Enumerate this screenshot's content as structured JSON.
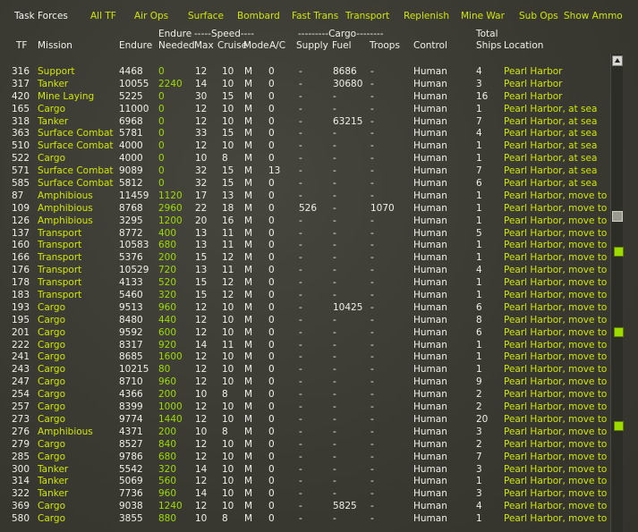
{
  "menu": {
    "task_forces": "Task Forces",
    "items": [
      "All TF",
      "Air Ops",
      "Surface",
      "Bombard",
      "Fast Trans",
      "Transport",
      "Replenish",
      "Mine War",
      "Sub Ops",
      "Show Ammo"
    ]
  },
  "headers": {
    "tf": "TF",
    "mission": "Mission",
    "endure": "Endure",
    "endure_top": "Endure",
    "needed": "Needed",
    "speed_group": "-----Speed----",
    "max": "Max",
    "cruise": "Cruise",
    "mode": "Mode",
    "ac": "A/C",
    "cargo_group": "---------Cargo--------",
    "supply": "Supply",
    "fuel": "Fuel",
    "troops": "Troops",
    "control": "Control",
    "total": "Total",
    "ships": "Ships",
    "location": "Location"
  },
  "rows": [
    {
      "tf": "316",
      "mission": "Support",
      "endure": "4468",
      "needed": "0",
      "max": "12",
      "cruise": "10",
      "mode": "M",
      "ac": "0",
      "supply": "-",
      "fuel": "8686",
      "troops": "-",
      "control": "Human",
      "ships": "4",
      "location": "Pearl Harbor"
    },
    {
      "tf": "317",
      "mission": "Tanker",
      "endure": "10055",
      "needed": "2240",
      "max": "14",
      "cruise": "10",
      "mode": "M",
      "ac": "0",
      "supply": "-",
      "fuel": "30680",
      "troops": "-",
      "control": "Human",
      "ships": "3",
      "location": "Pearl Harbor"
    },
    {
      "tf": "420",
      "mission": "Mine Laying",
      "endure": "5225",
      "needed": "0",
      "max": "30",
      "cruise": "15",
      "mode": "M",
      "ac": "0",
      "supply": "-",
      "fuel": "-",
      "troops": "-",
      "control": "Human",
      "ships": "16",
      "location": "Pearl Harbor"
    },
    {
      "tf": "165",
      "mission": "Cargo",
      "endure": "11000",
      "needed": "0",
      "max": "12",
      "cruise": "10",
      "mode": "M",
      "ac": "0",
      "supply": "-",
      "fuel": "-",
      "troops": "-",
      "control": "Human",
      "ships": "1",
      "location": "Pearl Harbor, at sea"
    },
    {
      "tf": "318",
      "mission": "Tanker",
      "endure": "6968",
      "needed": "0",
      "max": "12",
      "cruise": "10",
      "mode": "M",
      "ac": "0",
      "supply": "-",
      "fuel": "63215",
      "troops": "-",
      "control": "Human",
      "ships": "7",
      "location": "Pearl Harbor, at sea"
    },
    {
      "tf": "363",
      "mission": "Surface Combat",
      "endure": "5781",
      "needed": "0",
      "max": "33",
      "cruise": "15",
      "mode": "M",
      "ac": "0",
      "supply": "-",
      "fuel": "-",
      "troops": "-",
      "control": "Human",
      "ships": "4",
      "location": "Pearl Harbor, at sea"
    },
    {
      "tf": "510",
      "mission": "Surface Combat",
      "endure": "4000",
      "needed": "0",
      "max": "12",
      "cruise": "10",
      "mode": "M",
      "ac": "0",
      "supply": "-",
      "fuel": "-",
      "troops": "-",
      "control": "Human",
      "ships": "1",
      "location": "Pearl Harbor, at sea"
    },
    {
      "tf": "522",
      "mission": "Cargo",
      "endure": "4000",
      "needed": "0",
      "max": "10",
      "cruise": "8",
      "mode": "M",
      "ac": "0",
      "supply": "-",
      "fuel": "-",
      "troops": "-",
      "control": "Human",
      "ships": "1",
      "location": "Pearl Harbor, at sea"
    },
    {
      "tf": "571",
      "mission": "Surface Combat",
      "endure": "9089",
      "needed": "0",
      "max": "32",
      "cruise": "15",
      "mode": "M",
      "ac": "13",
      "supply": "-",
      "fuel": "-",
      "troops": "-",
      "control": "Human",
      "ships": "7",
      "location": "Pearl Harbor, at sea"
    },
    {
      "tf": "585",
      "mission": "Surface Combat",
      "endure": "5812",
      "needed": "0",
      "max": "32",
      "cruise": "15",
      "mode": "M",
      "ac": "0",
      "supply": "-",
      "fuel": "-",
      "troops": "-",
      "control": "Human",
      "ships": "6",
      "location": "Pearl Harbor, at sea"
    },
    {
      "tf": "87",
      "mission": "Amphibious",
      "endure": "11459",
      "needed": "1120",
      "max": "17",
      "cruise": "13",
      "mode": "M",
      "ac": "0",
      "supply": "-",
      "fuel": "-",
      "troops": "-",
      "control": "Human",
      "ships": "1",
      "location": "Pearl Harbor, move to"
    },
    {
      "tf": "109",
      "mission": "Amphibious",
      "endure": "8768",
      "needed": "2960",
      "max": "22",
      "cruise": "18",
      "mode": "M",
      "ac": "0",
      "supply": "526",
      "fuel": "-",
      "troops": "1070",
      "control": "Human",
      "ships": "1",
      "location": "Pearl Harbor, move to"
    },
    {
      "tf": "126",
      "mission": "Amphibious",
      "endure": "3295",
      "needed": "1200",
      "max": "20",
      "cruise": "16",
      "mode": "M",
      "ac": "0",
      "supply": "-",
      "fuel": "-",
      "troops": "-",
      "control": "Human",
      "ships": "1",
      "location": "Pearl Harbor, move to"
    },
    {
      "tf": "137",
      "mission": "Transport",
      "endure": "8772",
      "needed": "400",
      "max": "13",
      "cruise": "11",
      "mode": "M",
      "ac": "0",
      "supply": "-",
      "fuel": "-",
      "troops": "-",
      "control": "Human",
      "ships": "5",
      "location": "Pearl Harbor, move to"
    },
    {
      "tf": "160",
      "mission": "Transport",
      "endure": "10583",
      "needed": "680",
      "max": "13",
      "cruise": "11",
      "mode": "M",
      "ac": "0",
      "supply": "-",
      "fuel": "-",
      "troops": "-",
      "control": "Human",
      "ships": "1",
      "location": "Pearl Harbor, move to"
    },
    {
      "tf": "166",
      "mission": "Transport",
      "endure": "5376",
      "needed": "200",
      "max": "15",
      "cruise": "12",
      "mode": "M",
      "ac": "0",
      "supply": "-",
      "fuel": "-",
      "troops": "-",
      "control": "Human",
      "ships": "1",
      "location": "Pearl Harbor, move to"
    },
    {
      "tf": "176",
      "mission": "Transport",
      "endure": "10529",
      "needed": "720",
      "max": "13",
      "cruise": "11",
      "mode": "M",
      "ac": "0",
      "supply": "-",
      "fuel": "-",
      "troops": "-",
      "control": "Human",
      "ships": "4",
      "location": "Pearl Harbor, move to"
    },
    {
      "tf": "178",
      "mission": "Transport",
      "endure": "4133",
      "needed": "520",
      "max": "15",
      "cruise": "12",
      "mode": "M",
      "ac": "0",
      "supply": "-",
      "fuel": "-",
      "troops": "-",
      "control": "Human",
      "ships": "1",
      "location": "Pearl Harbor, move to"
    },
    {
      "tf": "183",
      "mission": "Transport",
      "endure": "5460",
      "needed": "320",
      "max": "15",
      "cruise": "12",
      "mode": "M",
      "ac": "0",
      "supply": "-",
      "fuel": "-",
      "troops": "-",
      "control": "Human",
      "ships": "1",
      "location": "Pearl Harbor, move to"
    },
    {
      "tf": "193",
      "mission": "Cargo",
      "endure": "9513",
      "needed": "960",
      "max": "12",
      "cruise": "10",
      "mode": "M",
      "ac": "0",
      "supply": "-",
      "fuel": "10425",
      "troops": "-",
      "control": "Human",
      "ships": "6",
      "location": "Pearl Harbor, move to"
    },
    {
      "tf": "195",
      "mission": "Cargo",
      "endure": "8480",
      "needed": "440",
      "max": "12",
      "cruise": "10",
      "mode": "M",
      "ac": "0",
      "supply": "-",
      "fuel": "-",
      "troops": "-",
      "control": "Human",
      "ships": "8",
      "location": "Pearl Harbor, move to"
    },
    {
      "tf": "201",
      "mission": "Cargo",
      "endure": "9592",
      "needed": "600",
      "max": "12",
      "cruise": "10",
      "mode": "M",
      "ac": "0",
      "supply": "-",
      "fuel": "-",
      "troops": "-",
      "control": "Human",
      "ships": "6",
      "location": "Pearl Harbor, move to"
    },
    {
      "tf": "222",
      "mission": "Cargo",
      "endure": "8317",
      "needed": "920",
      "max": "14",
      "cruise": "11",
      "mode": "M",
      "ac": "0",
      "supply": "-",
      "fuel": "-",
      "troops": "-",
      "control": "Human",
      "ships": "1",
      "location": "Pearl Harbor, move to"
    },
    {
      "tf": "241",
      "mission": "Cargo",
      "endure": "8685",
      "needed": "1600",
      "max": "12",
      "cruise": "10",
      "mode": "M",
      "ac": "0",
      "supply": "-",
      "fuel": "-",
      "troops": "-",
      "control": "Human",
      "ships": "1",
      "location": "Pearl Harbor, move to"
    },
    {
      "tf": "243",
      "mission": "Cargo",
      "endure": "10215",
      "needed": "80",
      "max": "12",
      "cruise": "10",
      "mode": "M",
      "ac": "0",
      "supply": "-",
      "fuel": "-",
      "troops": "-",
      "control": "Human",
      "ships": "1",
      "location": "Pearl Harbor, move to"
    },
    {
      "tf": "247",
      "mission": "Cargo",
      "endure": "8710",
      "needed": "960",
      "max": "12",
      "cruise": "10",
      "mode": "M",
      "ac": "0",
      "supply": "-",
      "fuel": "-",
      "troops": "-",
      "control": "Human",
      "ships": "9",
      "location": "Pearl Harbor, move to"
    },
    {
      "tf": "254",
      "mission": "Cargo",
      "endure": "4366",
      "needed": "200",
      "max": "10",
      "cruise": "8",
      "mode": "M",
      "ac": "0",
      "supply": "-",
      "fuel": "-",
      "troops": "-",
      "control": "Human",
      "ships": "2",
      "location": "Pearl Harbor, move to"
    },
    {
      "tf": "257",
      "mission": "Cargo",
      "endure": "8399",
      "needed": "1000",
      "max": "12",
      "cruise": "10",
      "mode": "M",
      "ac": "0",
      "supply": "-",
      "fuel": "-",
      "troops": "-",
      "control": "Human",
      "ships": "2",
      "location": "Pearl Harbor, move to"
    },
    {
      "tf": "273",
      "mission": "Cargo",
      "endure": "9774",
      "needed": "1440",
      "max": "12",
      "cruise": "10",
      "mode": "M",
      "ac": "0",
      "supply": "-",
      "fuel": "-",
      "troops": "-",
      "control": "Human",
      "ships": "20",
      "location": "Pearl Harbor, move to"
    },
    {
      "tf": "276",
      "mission": "Amphibious",
      "endure": "4371",
      "needed": "200",
      "max": "10",
      "cruise": "8",
      "mode": "M",
      "ac": "0",
      "supply": "-",
      "fuel": "-",
      "troops": "-",
      "control": "Human",
      "ships": "3",
      "location": "Pearl Harbor, move to"
    },
    {
      "tf": "279",
      "mission": "Cargo",
      "endure": "8527",
      "needed": "840",
      "max": "12",
      "cruise": "10",
      "mode": "M",
      "ac": "0",
      "supply": "-",
      "fuel": "-",
      "troops": "-",
      "control": "Human",
      "ships": "2",
      "location": "Pearl Harbor, move to"
    },
    {
      "tf": "285",
      "mission": "Cargo",
      "endure": "9786",
      "needed": "680",
      "max": "12",
      "cruise": "10",
      "mode": "M",
      "ac": "0",
      "supply": "-",
      "fuel": "-",
      "troops": "-",
      "control": "Human",
      "ships": "7",
      "location": "Pearl Harbor, move to"
    },
    {
      "tf": "300",
      "mission": "Tanker",
      "endure": "5542",
      "needed": "320",
      "max": "14",
      "cruise": "10",
      "mode": "M",
      "ac": "0",
      "supply": "-",
      "fuel": "-",
      "troops": "-",
      "control": "Human",
      "ships": "3",
      "location": "Pearl Harbor, move to"
    },
    {
      "tf": "314",
      "mission": "Tanker",
      "endure": "5069",
      "needed": "560",
      "max": "12",
      "cruise": "10",
      "mode": "M",
      "ac": "0",
      "supply": "-",
      "fuel": "-",
      "troops": "-",
      "control": "Human",
      "ships": "1",
      "location": "Pearl Harbor, move to"
    },
    {
      "tf": "322",
      "mission": "Tanker",
      "endure": "7736",
      "needed": "960",
      "max": "14",
      "cruise": "10",
      "mode": "M",
      "ac": "0",
      "supply": "-",
      "fuel": "-",
      "troops": "-",
      "control": "Human",
      "ships": "3",
      "location": "Pearl Harbor, move to"
    },
    {
      "tf": "369",
      "mission": "Cargo",
      "endure": "9038",
      "needed": "1240",
      "max": "12",
      "cruise": "10",
      "mode": "M",
      "ac": "0",
      "supply": "-",
      "fuel": "5825",
      "troops": "-",
      "control": "Human",
      "ships": "4",
      "location": "Pearl Harbor, move to"
    },
    {
      "tf": "580",
      "mission": "Cargo",
      "endure": "3855",
      "needed": "880",
      "max": "10",
      "cruise": "8",
      "mode": "M",
      "ac": "0",
      "supply": "-",
      "fuel": "-",
      "troops": "-",
      "control": "Human",
      "ships": "1",
      "location": "Pearl Harbor, move to"
    }
  ]
}
